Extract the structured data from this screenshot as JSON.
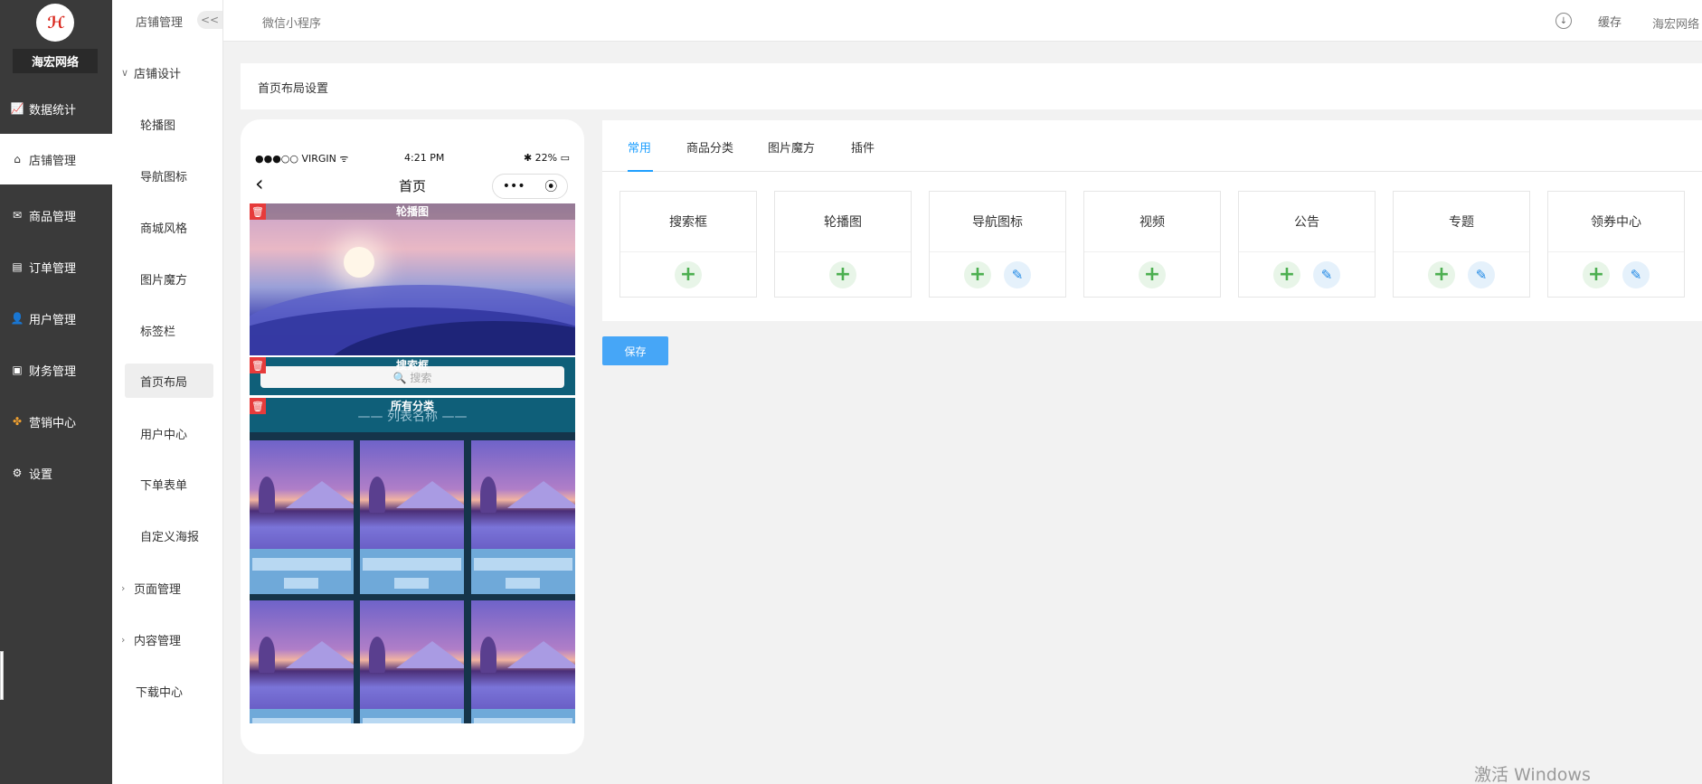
{
  "brand": {
    "name": "海宏网络"
  },
  "nav": {
    "items": [
      {
        "label": "数据统计",
        "icon": "chart-icon"
      },
      {
        "label": "店铺管理",
        "icon": "store-icon"
      },
      {
        "label": "商品管理",
        "icon": "envelope-icon"
      },
      {
        "label": "订单管理",
        "icon": "order-icon"
      },
      {
        "label": "用户管理",
        "icon": "user-icon"
      },
      {
        "label": "财务管理",
        "icon": "finance-icon"
      },
      {
        "label": "营销中心",
        "icon": "marketing-icon"
      },
      {
        "label": "设置",
        "icon": "gear-icon"
      }
    ],
    "active_index": 1
  },
  "subnav": {
    "title": "店铺管理",
    "collapse_label": "<<",
    "group_design": "店铺设计",
    "items": [
      "轮播图",
      "导航图标",
      "商城风格",
      "图片魔方",
      "标签栏",
      "首页布局",
      "用户中心",
      "下单表单",
      "自定义海报"
    ],
    "active_item": "首页布局",
    "group_page": "页面管理",
    "group_content": "内容管理",
    "download": "下载中心"
  },
  "topbar": {
    "breadcrumb": "微信小程序",
    "cache_label": "缓存",
    "user_label": "海宏网络"
  },
  "page": {
    "title": "首页布局设置"
  },
  "phone": {
    "status_left": "●●●○○ VIRGIN ᯤ",
    "status_time": "4:21 PM",
    "status_right": "✱ 22% ▭",
    "nav_back": "‹",
    "nav_title": "首页",
    "capsule_more": "•••",
    "capsule_close": "⦿",
    "blocks": {
      "banner_label": "轮播图",
      "search_label": "搜索框",
      "search_placeholder": "🔍 搜索",
      "category_label": "所有分类",
      "category_title": "—— 列表名称 ——"
    }
  },
  "tabs": [
    {
      "label": "常用",
      "active": true
    },
    {
      "label": "商品分类",
      "active": false
    },
    {
      "label": "图片魔方",
      "active": false
    },
    {
      "label": "插件",
      "active": false
    }
  ],
  "components": [
    {
      "name": "搜索框",
      "editable": false
    },
    {
      "name": "轮播图",
      "editable": false
    },
    {
      "name": "导航图标",
      "editable": true
    },
    {
      "name": "视频",
      "editable": false
    },
    {
      "name": "公告",
      "editable": true
    },
    {
      "name": "专题",
      "editable": true
    },
    {
      "name": "领券中心",
      "editable": true
    }
  ],
  "actions": {
    "save_label": "保存",
    "add_symbol": "+",
    "edit_symbol": "✎",
    "trash_symbol": "🗑"
  },
  "watermark": "激活 Windows",
  "colors": {
    "accent": "#1e9fff",
    "save": "#46a6f7",
    "add": "#4caf50",
    "edit": "#1e88e5",
    "trash": "#e63b3b",
    "nav_bg": "#3a3a3a"
  }
}
